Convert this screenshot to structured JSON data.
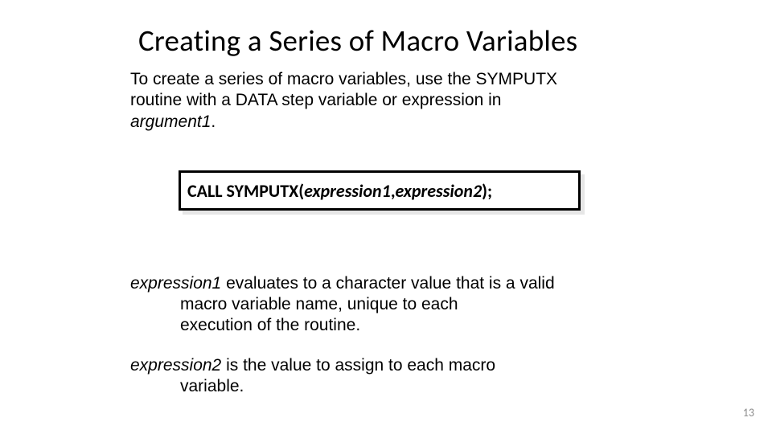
{
  "title": "Creating a Series of Macro Variables",
  "intro": {
    "line1": "To create a series of macro variables, use the SYMPUTX",
    "line2": "routine with a DATA step variable or expression in",
    "arg": "argument1",
    "period": "."
  },
  "code": {
    "prefix": "CALL SYMPUTX(",
    "expr1": "expression1",
    "comma": ",",
    "expr2": "expression2",
    "suffix": ");"
  },
  "defs": {
    "d1": {
      "term": "expression1",
      "rest_a": "  evaluates to a character value that is a valid",
      "rest_b": "macro variable name, unique to each",
      "rest_c": "execution of the routine."
    },
    "d2": {
      "term": "expression2",
      "rest_a": "  is the value to assign to each macro",
      "rest_b": "variable."
    }
  },
  "page": "13"
}
